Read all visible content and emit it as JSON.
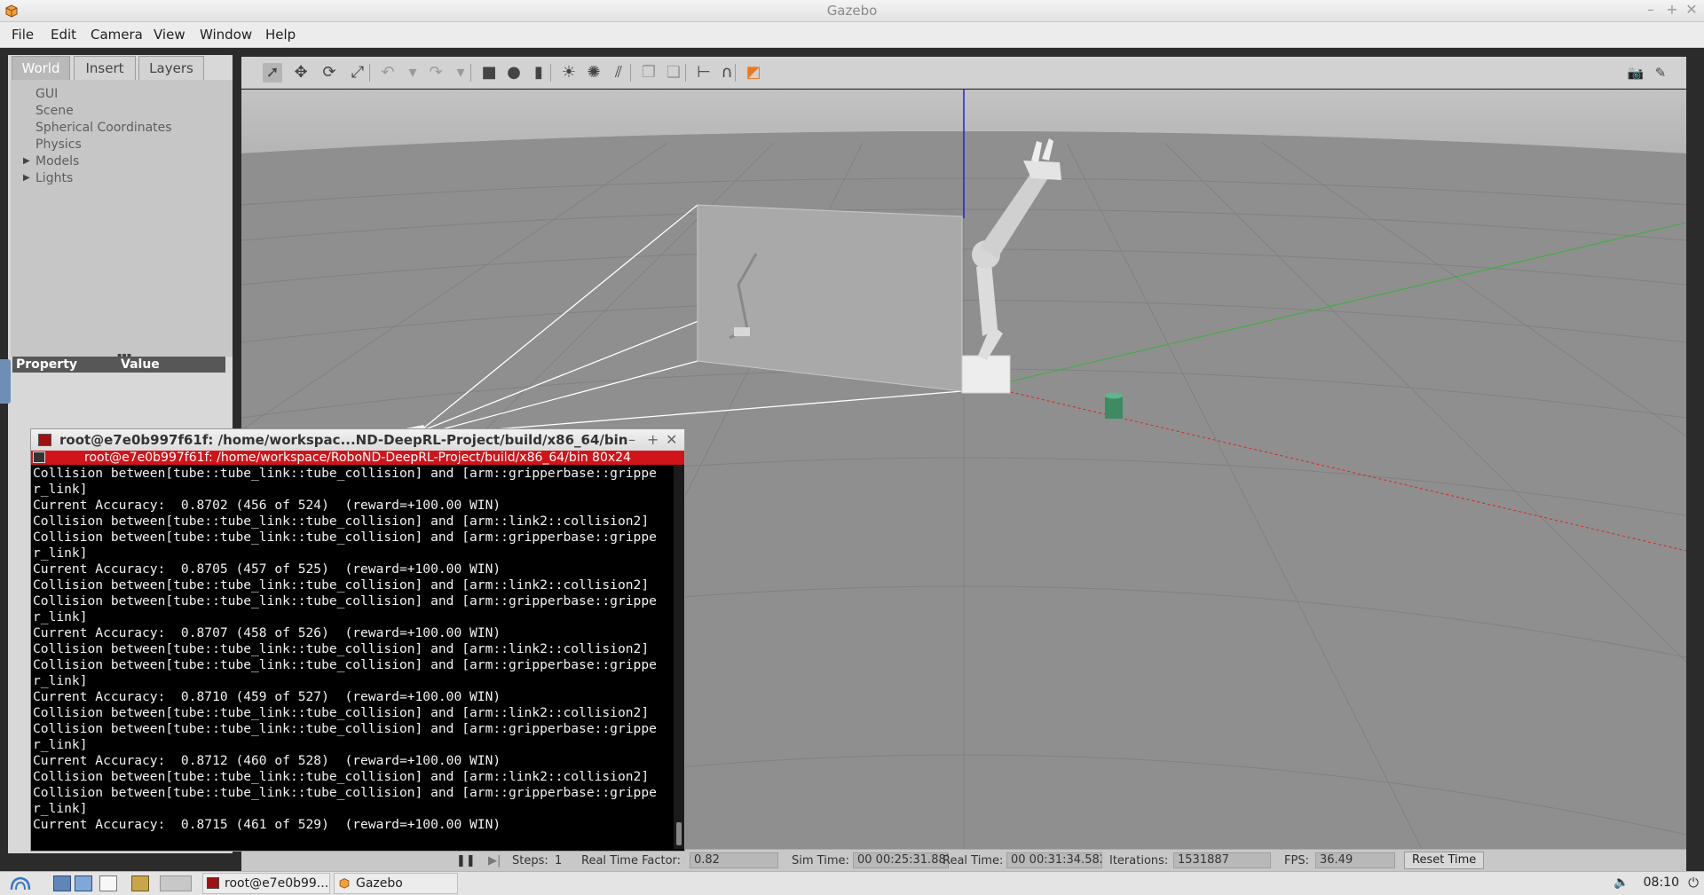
{
  "window": {
    "title": "Gazebo"
  },
  "menu": [
    "File",
    "Edit",
    "Camera",
    "View",
    "Window",
    "Help"
  ],
  "left_panel": {
    "tabs": [
      "World",
      "Insert",
      "Layers"
    ],
    "active_tab": "World",
    "tree": [
      {
        "label": "GUI",
        "expandable": false
      },
      {
        "label": "Scene",
        "expandable": false
      },
      {
        "label": "Spherical Coordinates",
        "expandable": false
      },
      {
        "label": "Physics",
        "expandable": false
      },
      {
        "label": "Models",
        "expandable": true
      },
      {
        "label": "Lights",
        "expandable": true
      }
    ],
    "property_header": {
      "property": "Property",
      "value": "Value"
    }
  },
  "toolbar": {
    "tools": [
      {
        "name": "select-mode-icon",
        "glyph": "➚"
      },
      {
        "name": "translate-mode-icon",
        "glyph": "✥"
      },
      {
        "name": "rotate-mode-icon",
        "glyph": "⟳"
      },
      {
        "name": "scale-mode-icon",
        "glyph": "⤢"
      },
      {
        "name": "undo-icon",
        "glyph": "↶"
      },
      {
        "name": "undo-history-icon",
        "glyph": "▾"
      },
      {
        "name": "redo-icon",
        "glyph": "↷"
      },
      {
        "name": "redo-history-icon",
        "glyph": "▾"
      },
      {
        "name": "box-shape-icon",
        "glyph": "■"
      },
      {
        "name": "sphere-shape-icon",
        "glyph": "●"
      },
      {
        "name": "cylinder-shape-icon",
        "glyph": "▮"
      },
      {
        "name": "point-light-icon",
        "glyph": "☀"
      },
      {
        "name": "spot-light-icon",
        "glyph": "✺"
      },
      {
        "name": "directional-light-icon",
        "glyph": "⫽"
      },
      {
        "name": "copy-icon",
        "glyph": "❐"
      },
      {
        "name": "paste-icon",
        "glyph": "❏"
      },
      {
        "name": "align-icon",
        "glyph": "⊢"
      },
      {
        "name": "snap-icon",
        "glyph": "∩"
      },
      {
        "name": "change-view-icon",
        "glyph": "◩"
      }
    ],
    "right_tools": [
      {
        "name": "screenshot-icon",
        "glyph": "📷"
      },
      {
        "name": "log-data-icon",
        "glyph": "✎"
      }
    ]
  },
  "statusbar": {
    "steps_label": "Steps:",
    "steps_value": "1",
    "rtf_label": "Real Time Factor:",
    "rtf_value": "0.82",
    "sim_time_label": "Sim Time:",
    "sim_time_value": "00 00:25:31.887",
    "real_time_label": "Real Time:",
    "real_time_value": "00 00:31:34.582",
    "iterations_label": "Iterations:",
    "iterations_value": "1531887",
    "fps_label": "FPS:",
    "fps_value": "36.49",
    "reset_time": "Reset Time"
  },
  "terminal": {
    "title": "root@e7e0b997f61f: /home/workspac...ND-DeepRL-Project/build/x86_64/bin",
    "subtitle": "root@e7e0b997f61f: /home/workspace/RoboND-DeepRL-Project/build/x86_64/bin 80x24",
    "lines": [
      "Collision between[tube::tube_link::tube_collision] and [arm::gripperbase::grippe",
      "r_link]",
      "Current Accuracy:  0.8702 (456 of 524)  (reward=+100.00 WIN)",
      "Collision between[tube::tube_link::tube_collision] and [arm::link2::collision2]",
      "Collision between[tube::tube_link::tube_collision] and [arm::gripperbase::grippe",
      "r_link]",
      "Current Accuracy:  0.8705 (457 of 525)  (reward=+100.00 WIN)",
      "Collision between[tube::tube_link::tube_collision] and [arm::link2::collision2]",
      "Collision between[tube::tube_link::tube_collision] and [arm::gripperbase::grippe",
      "r_link]",
      "Current Accuracy:  0.8707 (458 of 526)  (reward=+100.00 WIN)",
      "Collision between[tube::tube_link::tube_collision] and [arm::link2::collision2]",
      "Collision between[tube::tube_link::tube_collision] and [arm::gripperbase::grippe",
      "r_link]",
      "Current Accuracy:  0.8710 (459 of 527)  (reward=+100.00 WIN)",
      "Collision between[tube::tube_link::tube_collision] and [arm::link2::collision2]",
      "Collision between[tube::tube_link::tube_collision] and [arm::gripperbase::grippe",
      "r_link]",
      "Current Accuracy:  0.8712 (460 of 528)  (reward=+100.00 WIN)",
      "Collision between[tube::tube_link::tube_collision] and [arm::link2::collision2]",
      "Collision between[tube::tube_link::tube_collision] and [arm::gripperbase::grippe",
      "r_link]",
      "Current Accuracy:  0.8715 (461 of 529)  (reward=+100.00 WIN)",
      ""
    ]
  },
  "taskbar": {
    "tasks": [
      {
        "label": "root@e7e0b99...",
        "icon": "terminal-icon"
      },
      {
        "label": "Gazebo",
        "icon": "gazebo-icon"
      }
    ],
    "clock": "08:10"
  },
  "colors": {
    "terminal_subtitle_bg": "#d0141a",
    "viewport_bg": "#8e8e8e",
    "toolbar_accent": "#f07818"
  }
}
